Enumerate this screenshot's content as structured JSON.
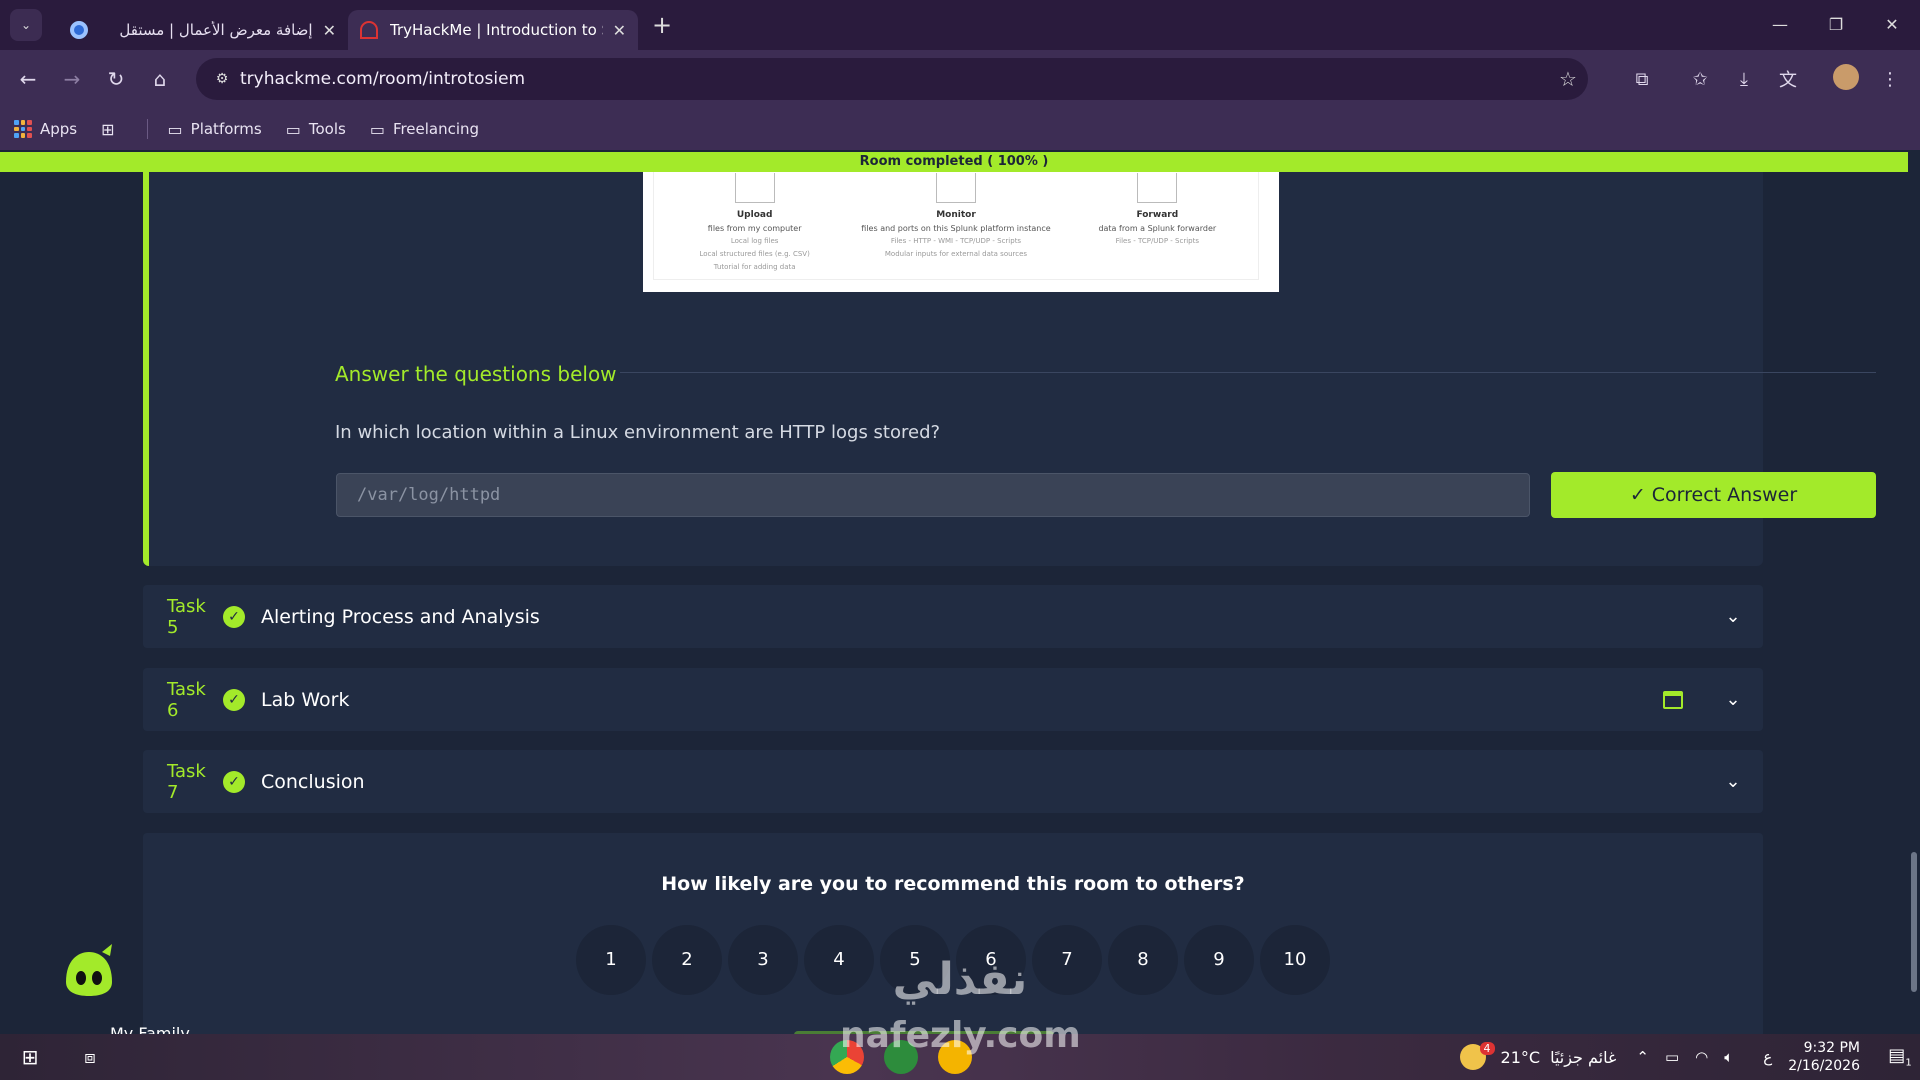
{
  "browser": {
    "tabs": [
      {
        "title": "إضافة معرض الأعمال | مستقل",
        "active": false
      },
      {
        "title": "TryHackMe | Introduction to SIEM",
        "active": true
      }
    ],
    "url": "tryhackme.com/room/introtosiem",
    "bookmarks": [
      "Apps",
      "Platforms",
      "Tools",
      "Freelancing"
    ]
  },
  "banner": {
    "text": "Room completed ( 100% )",
    "progress": 1.0
  },
  "task4": {
    "image": {
      "columns": [
        {
          "name": "Upload",
          "desc": "files from my computer",
          "lines": [
            "Local log files",
            "Local structured files (e.g. CSV)"
          ],
          "link": "Tutorial for adding data"
        },
        {
          "name": "Monitor",
          "desc": "files and ports on this Splunk platform instance",
          "lines": [
            "Files - HTTP - WMI - TCP/UDP - Scripts",
            "Modular inputs for external data sources"
          ]
        },
        {
          "name": "Forward",
          "desc": "data from a Splunk forwarder",
          "lines": [
            "Files - TCP/UDP - Scripts"
          ]
        }
      ]
    },
    "answer_heading": "Answer the questions below",
    "question": "In which location within a Linux environment are HTTP logs stored?",
    "answer_value": "/var/log/httpd",
    "correct_label": "✓ Correct Answer"
  },
  "tasks": [
    {
      "num": "Task 5",
      "title": "Alerting Process and Analysis",
      "has_vm": false
    },
    {
      "num": "Task 6",
      "title": "Lab Work",
      "has_vm": true
    },
    {
      "num": "Task 7",
      "title": "Conclusion",
      "has_vm": false
    }
  ],
  "rating": {
    "question": "How likely are you to recommend this room to others?",
    "scores": [
      "1",
      "2",
      "3",
      "4",
      "5",
      "6",
      "7",
      "8",
      "9",
      "10"
    ]
  },
  "watermark": {
    "line1": "نفذلي",
    "line2": "nafezly.com"
  },
  "peek_text": "My Family",
  "taskbar": {
    "weather_temp": "21°C",
    "weather_desc": "غائم جزئيًا",
    "weather_badge": "4",
    "lang": "ع",
    "time": "9:32 PM",
    "date": "2/16/2026",
    "notif_count": "1"
  },
  "colors": {
    "accent": "#a3ea2a",
    "card": "#212c42",
    "page": "#1c2538"
  }
}
